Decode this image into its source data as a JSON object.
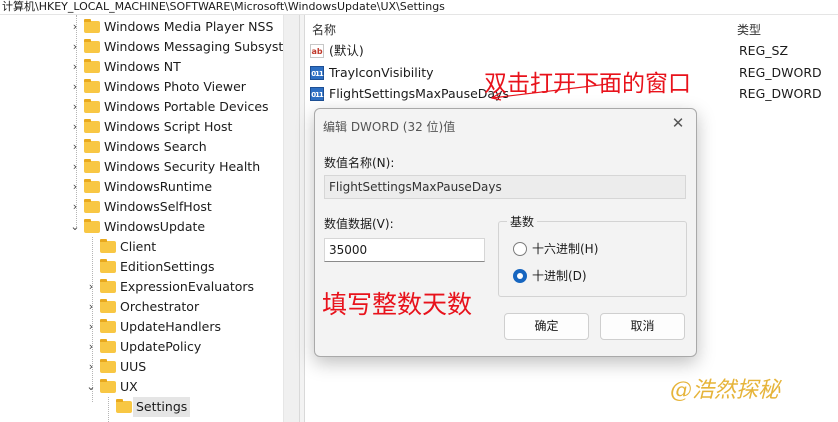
{
  "address": "计算机\\HKEY_LOCAL_MACHINE\\SOFTWARE\\Microsoft\\WindowsUpdate\\UX\\Settings",
  "tree": {
    "items": [
      {
        "label": "Windows Media Player NSS"
      },
      {
        "label": "Windows Messaging Subsyste"
      },
      {
        "label": "Windows NT"
      },
      {
        "label": "Windows Photo Viewer"
      },
      {
        "label": "Windows Portable Devices"
      },
      {
        "label": "Windows Script Host"
      },
      {
        "label": "Windows Search"
      },
      {
        "label": "Windows Security Health"
      },
      {
        "label": "WindowsRuntime"
      },
      {
        "label": "WindowsSelfHost"
      },
      {
        "label": "WindowsUpdate"
      },
      {
        "label": "Client"
      },
      {
        "label": "EditionSettings"
      },
      {
        "label": "ExpressionEvaluators"
      },
      {
        "label": "Orchestrator"
      },
      {
        "label": "UpdateHandlers"
      },
      {
        "label": "UpdatePolicy"
      },
      {
        "label": "UUS"
      },
      {
        "label": "UX"
      },
      {
        "label": "Settings"
      }
    ],
    "selected": "Settings"
  },
  "list": {
    "col_name": "名称",
    "col_type": "类型",
    "rows": [
      {
        "name": "(默认)",
        "type": "REG_SZ",
        "icon": "string-value-icon"
      },
      {
        "name": "TrayIconVisibility",
        "type": "REG_DWORD",
        "icon": "binary-value-icon"
      },
      {
        "name": "FlightSettingsMaxPauseDays",
        "type": "REG_DWORD",
        "icon": "binary-value-icon"
      }
    ]
  },
  "dialog": {
    "title": "编辑 DWORD (32 位)值",
    "name_label": "数值名称(N):",
    "name_value": "FlightSettingsMaxPauseDays",
    "data_label": "数值数据(V):",
    "data_value": "35000",
    "base_label": "基数",
    "hex_label": "十六进制(H)",
    "dec_label": "十进制(D)",
    "selected_base": "decimal",
    "ok_label": "确定",
    "cancel_label": "取消"
  },
  "annotations": {
    "top": "双击打开下面的窗口",
    "middle": "填写整数天数",
    "color": "#e8121b"
  },
  "watermark": "@浩然探秘"
}
